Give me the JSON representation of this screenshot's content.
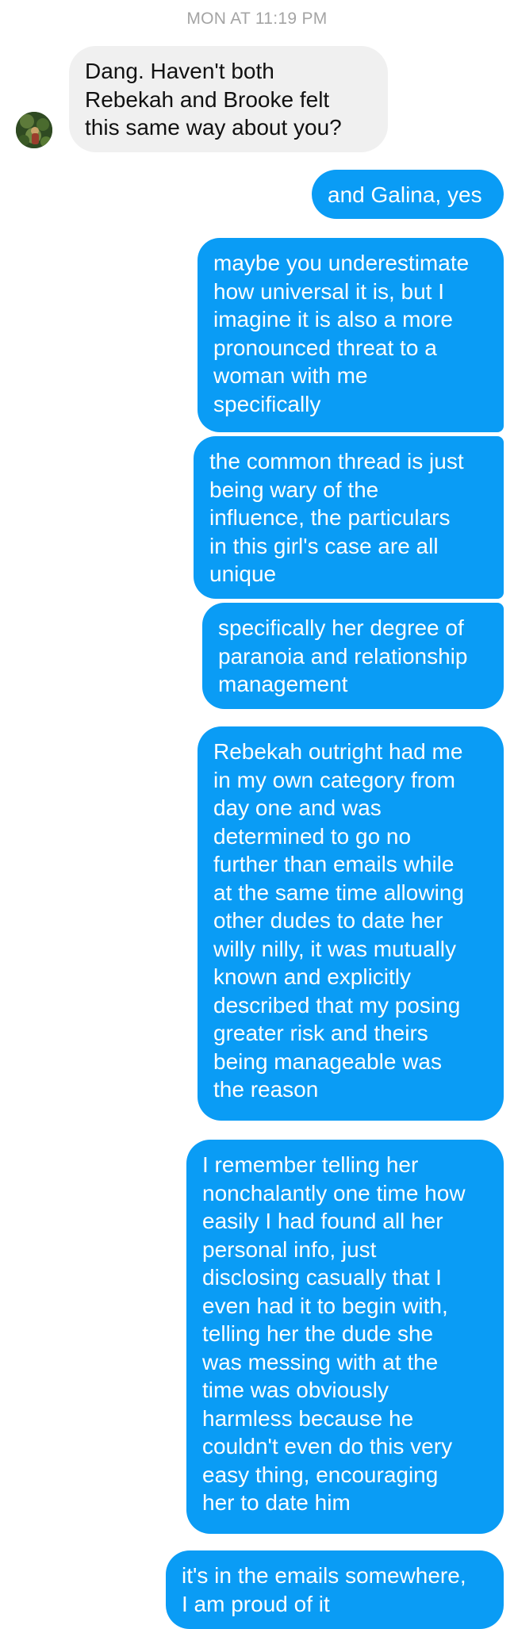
{
  "conversation": {
    "timestamp": "MON AT 11:19 PM",
    "messages": [
      {
        "direction": "incoming",
        "text": "Dang. Haven't both\nRebekah and Brooke felt\nthis same way about you?"
      },
      {
        "direction": "outgoing",
        "text": "and Galina, yes"
      },
      {
        "direction": "outgoing",
        "text": "maybe you underestimate\nhow universal it is, but I\nimagine it is also a more\npronounced threat to a\nwoman with me\nspecifically"
      },
      {
        "direction": "outgoing",
        "text": "the common thread is just\nbeing wary of the\ninfluence, the particulars\nin this girl's case are all\nunique"
      },
      {
        "direction": "outgoing",
        "text": "specifically her degree of\nparanoia and relationship\nmanagement"
      },
      {
        "direction": "outgoing",
        "text": "Rebekah outright had me\nin my own category from\nday one and was\ndetermined to go no\nfurther than emails while\nat the same time allowing\nother dudes to date her\nwilly nilly, it was mutually\nknown and explicitly\ndescribed that my posing\ngreater risk and theirs\nbeing manageable was\nthe reason"
      },
      {
        "direction": "outgoing",
        "text": "I remember telling her\nnonchalantly one time how\neasily I had found all her\npersonal info, just\ndisclosing casually that I\neven had it to begin with,\ntelling her the dude she\nwas messing with at the\ntime was obviously\nharmless because he\ncouldn't even do this very\neasy thing, encouraging\nher to date him"
      },
      {
        "direction": "outgoing",
        "text": "it's in the emails somewhere,\nI am proud of it"
      }
    ]
  }
}
